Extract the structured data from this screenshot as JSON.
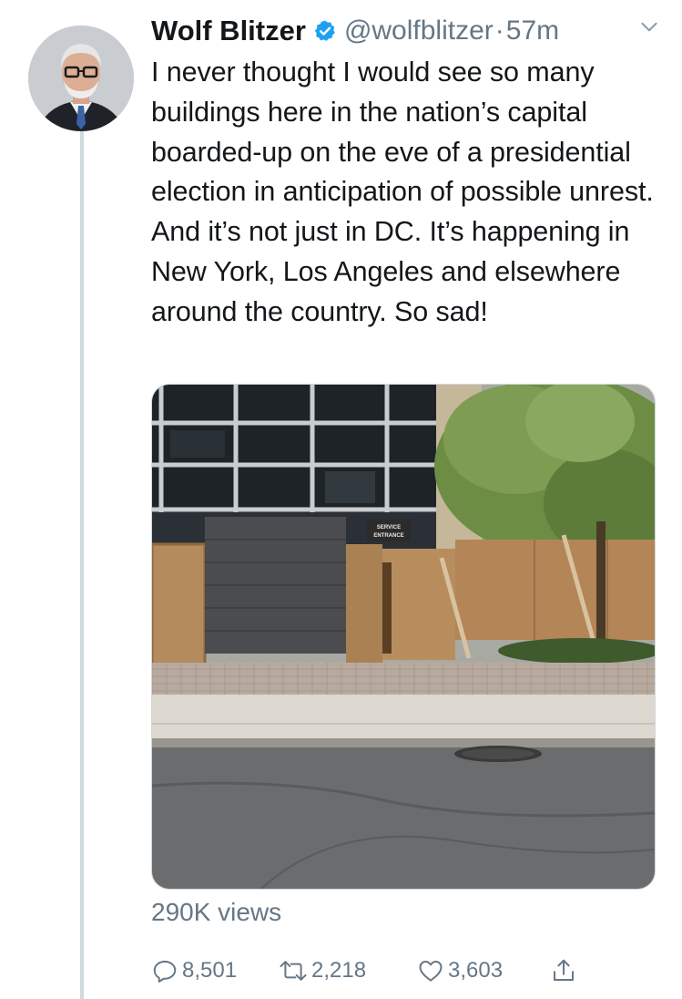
{
  "tweet": {
    "display_name": "Wolf Blitzer",
    "handle": "@wolfblitzer",
    "separator": "·",
    "timestamp": "57m",
    "text": "I never thought I would see so many buildings here in the nation’s capital boarded-up on the eve of a presidential election in anticipation of possible unrest. And it’s not just in DC. It’s happening in New York, Los Angeles and elsewhere around the country. So sad!",
    "media": {
      "sign_line1": "SERVICE",
      "sign_line2": "ENTRANCE"
    },
    "views": "290K views",
    "actions": {
      "reply_count": "8,501",
      "retweet_count": "2,218",
      "like_count": "3,603"
    }
  },
  "colors": {
    "primary_text": "#14171a",
    "secondary_text": "#657786",
    "verified_blue": "#1da1f2",
    "thread_line": "#cfd9de"
  },
  "icons": [
    "verified-badge-icon",
    "chevron-down-icon",
    "reply-icon",
    "retweet-icon",
    "like-icon",
    "share-icon"
  ]
}
